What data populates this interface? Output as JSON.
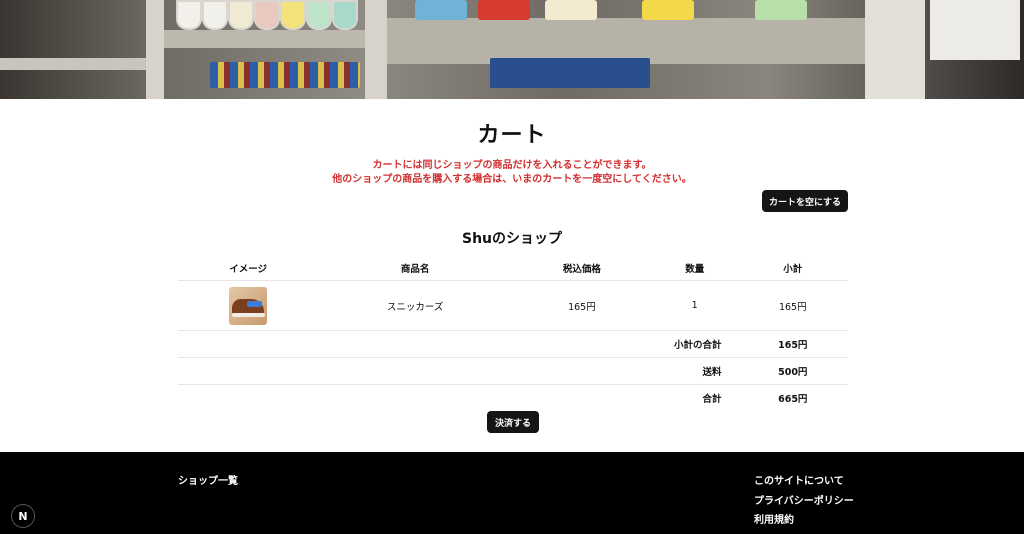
{
  "page": {
    "title": "カート"
  },
  "notice": {
    "line1": "カートには同じショップの商品だけを入れることができます。",
    "line2": "他のショップの商品を購入する場合は、いまのカートを一度空にしてください。"
  },
  "actions": {
    "empty_cart": "カートを空にする",
    "checkout": "決済する"
  },
  "shop": {
    "title": "Shuのショップ"
  },
  "table": {
    "headers": [
      "イメージ",
      "商品名",
      "税込価格",
      "数量",
      "小計"
    ],
    "items": [
      {
        "name": "スニッカーズ",
        "price": "165円",
        "quantity": "1",
        "subtotal": "165円",
        "image": "sneaker-thumbnail"
      }
    ],
    "summary": [
      {
        "label": "小計の合計",
        "value": "165円"
      },
      {
        "label": "送料",
        "value": "500円"
      },
      {
        "label": "合計",
        "value": "665円"
      }
    ]
  },
  "footer": {
    "left_link": "ショップ一覧",
    "right_links": [
      "このサイトについて",
      "プライバシーポリシー",
      "利用規約"
    ]
  },
  "badge": {
    "letter": "N"
  },
  "colors": {
    "notice": "#d32f2f",
    "button": "#151515",
    "footer": "#000000"
  }
}
